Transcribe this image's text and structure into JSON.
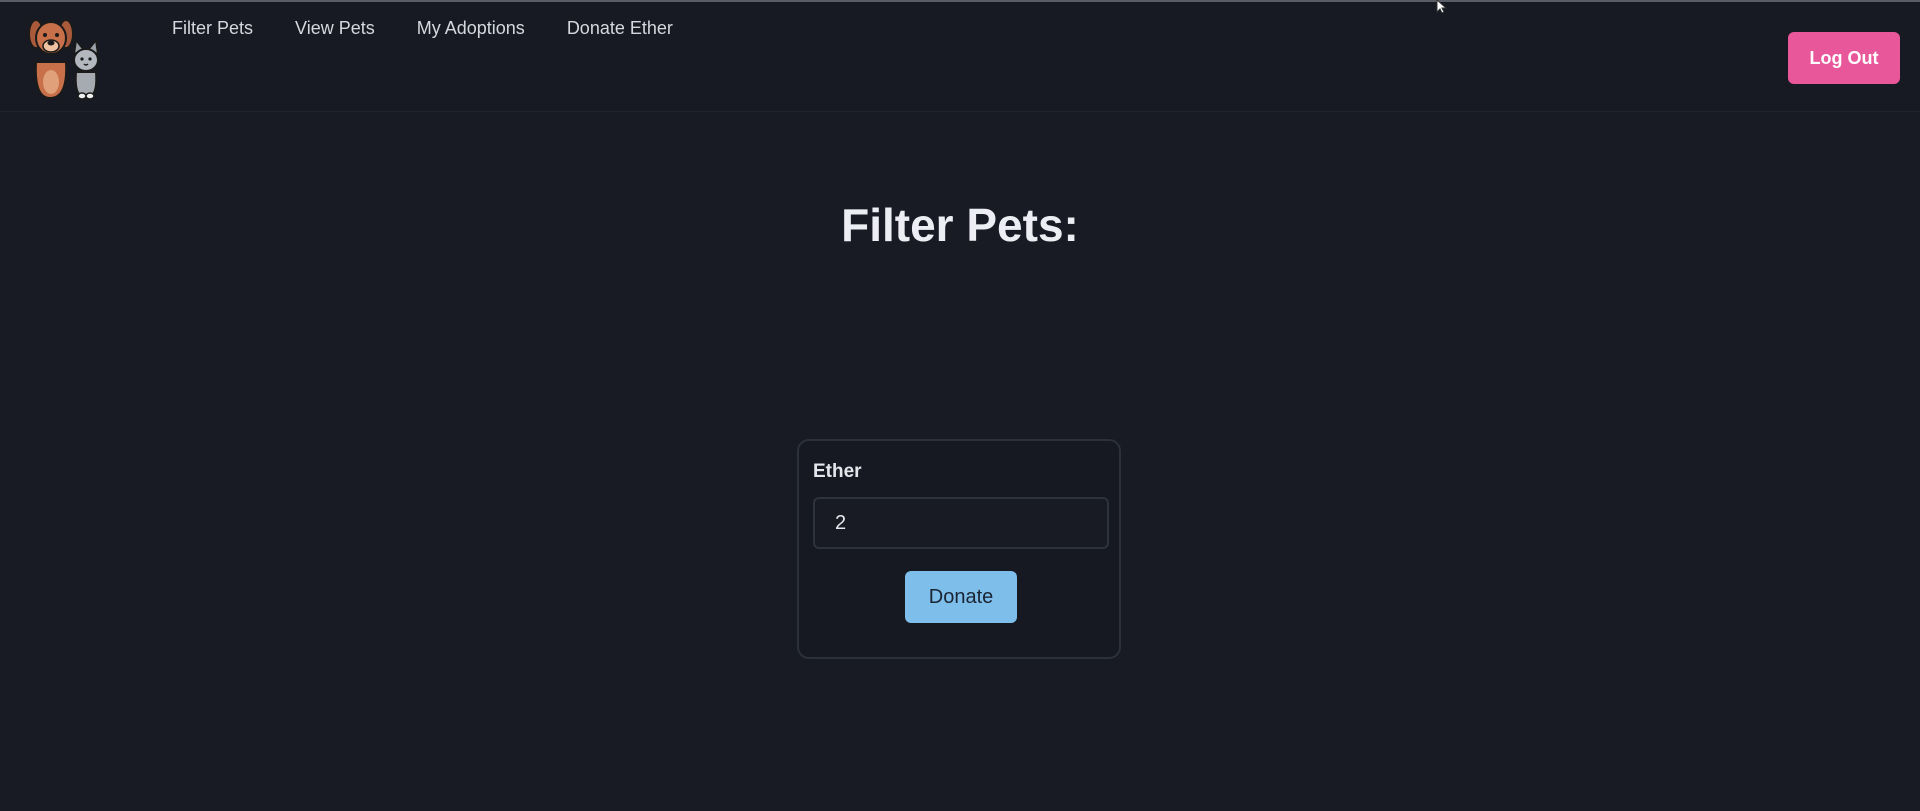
{
  "nav": {
    "links": [
      {
        "label": "Filter Pets"
      },
      {
        "label": "View Pets"
      },
      {
        "label": "My Adoptions"
      },
      {
        "label": "Donate Ether"
      }
    ],
    "logout_label": "Log Out",
    "logo_icon": "dog-and-cat-logo-icon"
  },
  "main": {
    "title": "Filter Pets:"
  },
  "donate_form": {
    "label": "Ether",
    "input_value": "2",
    "button_label": "Donate"
  },
  "colors": {
    "background": "#181b24",
    "logout_button": "#e8579a",
    "donate_button": "#7ebeea"
  }
}
